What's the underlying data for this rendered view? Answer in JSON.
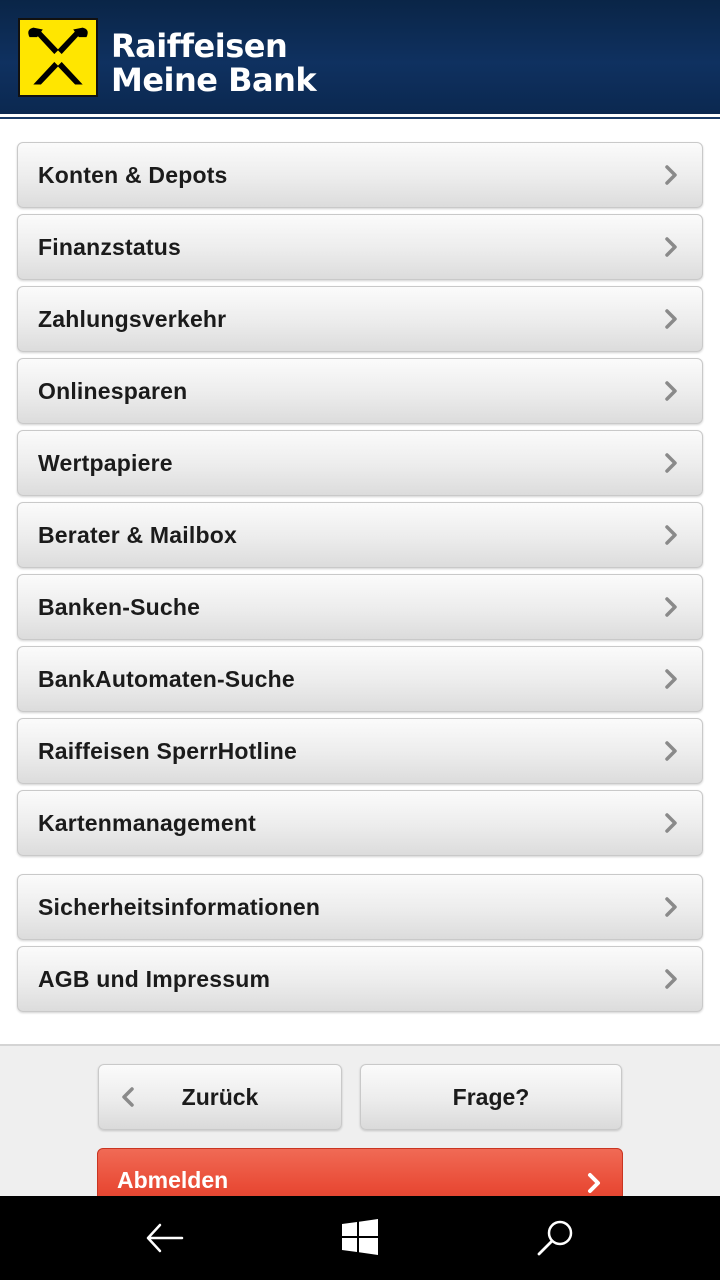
{
  "header": {
    "brand_line1": "Raiffeisen",
    "brand_line2": "Meine Bank",
    "logo_icon": "raiffeisen-crossed-horses-logo",
    "colors": {
      "header_bg": "#0f3160",
      "logo_bg": "#ffe600"
    }
  },
  "menu": {
    "items": [
      {
        "label": "Konten & Depots"
      },
      {
        "label": "Finanzstatus"
      },
      {
        "label": "Zahlungsverkehr"
      },
      {
        "label": "Onlinesparen"
      },
      {
        "label": "Wertpapiere"
      },
      {
        "label": "Berater & Mailbox"
      },
      {
        "label": "Banken-Suche"
      },
      {
        "label": "BankAutomaten-Suche"
      },
      {
        "label": "Raiffeisen SperrHotline"
      },
      {
        "label": "Kartenmanagement"
      },
      {
        "label": "Sicherheitsinformationen"
      },
      {
        "label": "AGB und Impressum"
      }
    ],
    "chevron_icon": "chevron-right-icon"
  },
  "footer": {
    "back_label": "Zurück",
    "question_label": "Frage?",
    "logout_label": "Abmelden",
    "colors": {
      "logout_bg": "#e94c37"
    }
  },
  "navbar": {
    "back_icon": "back-arrow-icon",
    "home_icon": "windows-logo-icon",
    "search_icon": "search-icon"
  }
}
